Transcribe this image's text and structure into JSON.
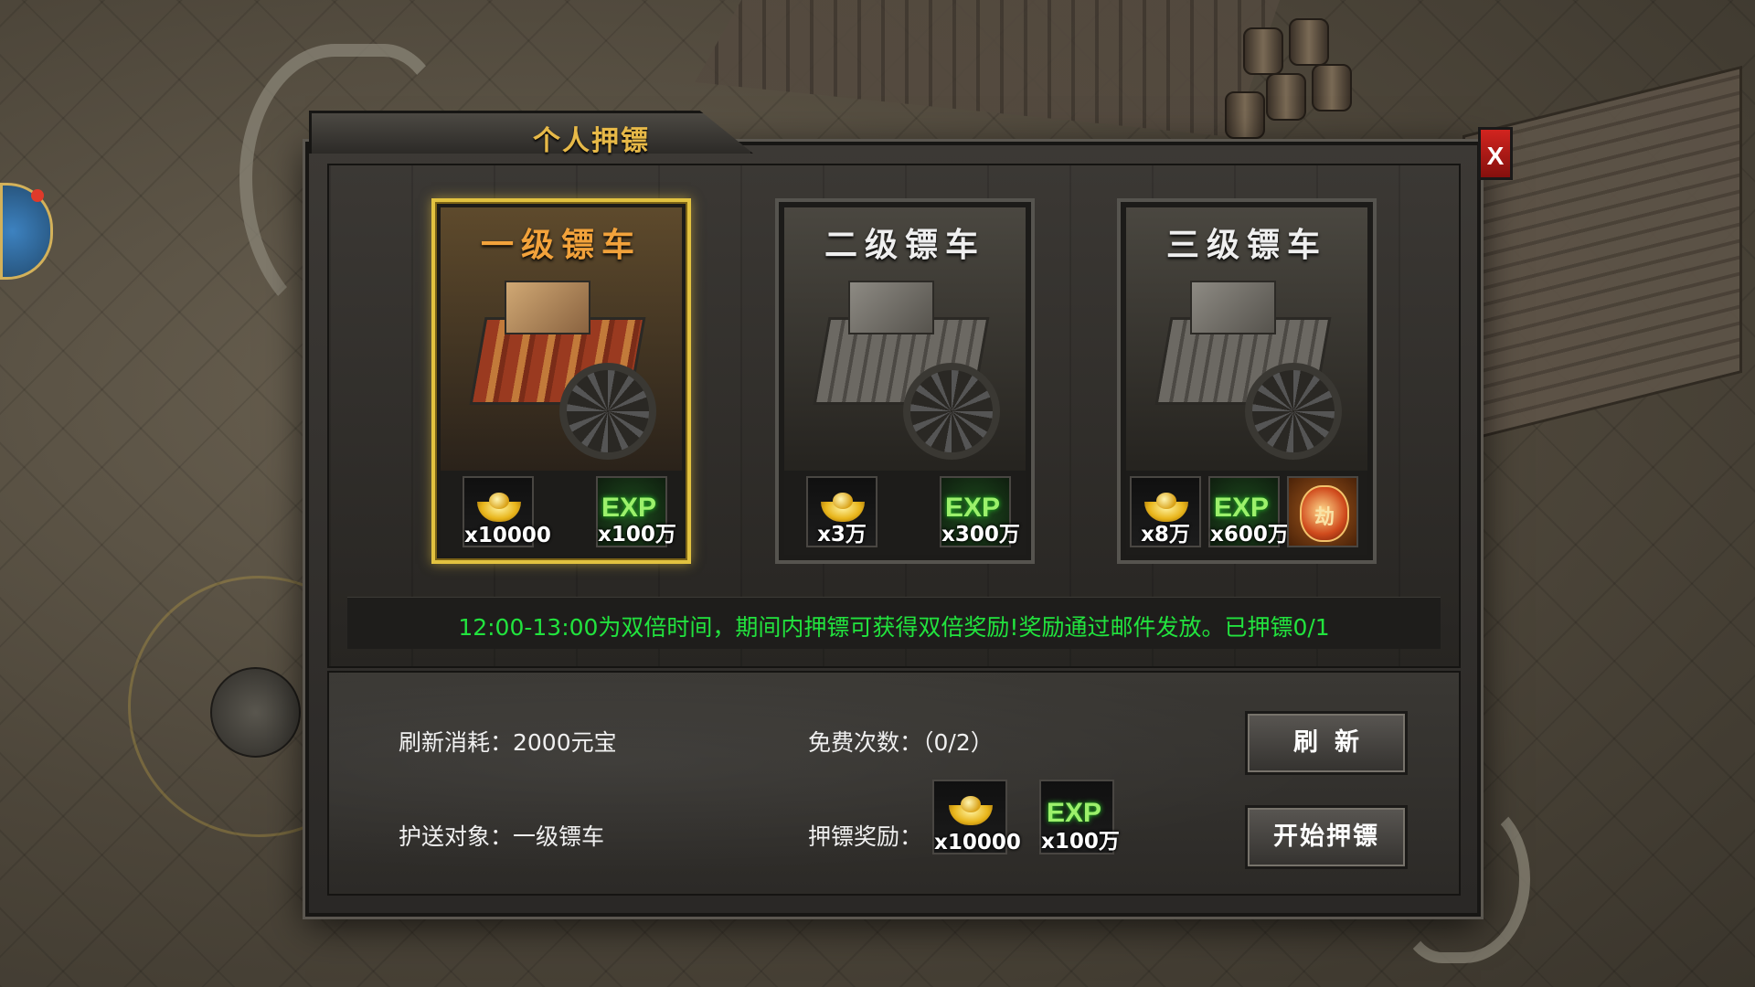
{
  "dialog": {
    "title": "个人押镖",
    "close_label": "X"
  },
  "carts": [
    {
      "name": "一级镖车",
      "selected": true,
      "rewards": [
        {
          "icon": "gold-ingot-icon",
          "qty": "x10000"
        },
        {
          "icon": "exp-icon",
          "label": "EXP",
          "qty": "x100万"
        }
      ]
    },
    {
      "name": "二级镖车",
      "selected": false,
      "rewards": [
        {
          "icon": "gold-ingot-icon",
          "qty": "x3万"
        },
        {
          "icon": "exp-icon",
          "label": "EXP",
          "qty": "x300万"
        }
      ]
    },
    {
      "name": "三级镖车",
      "selected": false,
      "rewards": [
        {
          "icon": "gold-ingot-icon",
          "qty": "x8万"
        },
        {
          "icon": "exp-icon",
          "label": "EXP",
          "qty": "x600万"
        },
        {
          "icon": "robbery-token-icon",
          "label": "劫"
        }
      ]
    }
  ],
  "notice": "12:00-13:00为双倍时间，期间内押镖可获得双倍奖励!奖励通过邮件发放。已押镖0/1",
  "info": {
    "refresh_cost": "刷新消耗：2000元宝",
    "free_count": "免费次数：（0/2）",
    "escort_target": "护送对象：一级镖车",
    "reward_label": "押镖奖励："
  },
  "escort_rewards": [
    {
      "icon": "gold-ingot-icon",
      "qty": "x10000"
    },
    {
      "icon": "exp-icon",
      "label": "EXP",
      "qty": "x100万"
    }
  ],
  "buttons": {
    "refresh": "刷新",
    "start_escort": "开始押镖"
  },
  "colors": {
    "notice_text": "#22e33e",
    "selected_border": "#e2c240",
    "title_gold": "#e7b948",
    "close_red": "#d2241f"
  }
}
